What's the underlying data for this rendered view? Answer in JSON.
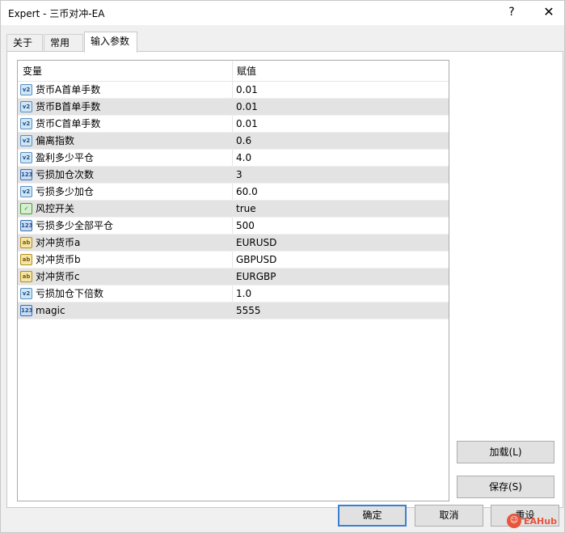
{
  "window": {
    "title": "Expert - 三币对冲-EA",
    "help_label": "?",
    "close_label": "✕"
  },
  "tabs": [
    {
      "label": "关于"
    },
    {
      "label": "常用"
    },
    {
      "label": "输入参数"
    }
  ],
  "table": {
    "headers": {
      "name": "变量",
      "value": "赋值"
    },
    "rows": [
      {
        "name": "货币A首单手数",
        "value": "0.01",
        "icon": "v2",
        "icon_name": "double-type-icon"
      },
      {
        "name": "货币B首单手数",
        "value": "0.01",
        "icon": "v2",
        "icon_name": "double-type-icon"
      },
      {
        "name": "货币C首单手数",
        "value": "0.01",
        "icon": "v2",
        "icon_name": "double-type-icon"
      },
      {
        "name": "偏离指数",
        "value": "0.6",
        "icon": "v2",
        "icon_name": "double-type-icon"
      },
      {
        "name": "盈利多少平仓",
        "value": "4.0",
        "icon": "v2",
        "icon_name": "double-type-icon"
      },
      {
        "name": "亏损加仓次数",
        "value": "3",
        "icon": "123",
        "icon_name": "integer-type-icon"
      },
      {
        "name": "亏损多少加仓",
        "value": "60.0",
        "icon": "v2",
        "icon_name": "double-type-icon"
      },
      {
        "name": "风控开关",
        "value": "true",
        "icon": "✓",
        "icon_name": "bool-type-icon"
      },
      {
        "name": "亏损多少全部平仓",
        "value": "500",
        "icon": "123",
        "icon_name": "integer-type-icon"
      },
      {
        "name": "对冲货币a",
        "value": "EURUSD",
        "icon": "ab",
        "icon_name": "string-type-icon"
      },
      {
        "name": "对冲货币b",
        "value": "GBPUSD",
        "icon": "ab",
        "icon_name": "string-type-icon"
      },
      {
        "name": "对冲货币c",
        "value": "EURGBP",
        "icon": "ab",
        "icon_name": "string-type-icon"
      },
      {
        "name": "亏损加仓下倍数",
        "value": "1.0",
        "icon": "v2",
        "icon_name": "double-type-icon"
      },
      {
        "name": "magic",
        "value": "5555",
        "icon": "123",
        "icon_name": "integer-type-icon"
      }
    ]
  },
  "buttons": {
    "load": "加载(L)",
    "save": "保存(S)",
    "ok": "确定",
    "cancel": "取消",
    "reset": "重设"
  },
  "watermark": {
    "text": "EAHub",
    "icon_name": "eahub-logo-icon"
  }
}
